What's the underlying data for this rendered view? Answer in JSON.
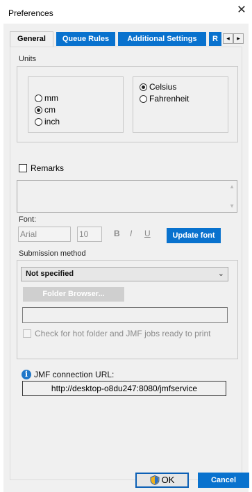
{
  "window": {
    "title": "Preferences",
    "close_glyph": "✕"
  },
  "tabs": [
    {
      "label": "General"
    },
    {
      "label": "Queue Rules"
    },
    {
      "label": "Additional Settings"
    },
    {
      "label": "R"
    }
  ],
  "tab_scroll": {
    "left": "◂",
    "right": "▸"
  },
  "units": {
    "section_label": "Units",
    "length_options": [
      {
        "label": "mm",
        "selected": false
      },
      {
        "label": "cm",
        "selected": true
      },
      {
        "label": "inch",
        "selected": false
      }
    ],
    "temperature_options": [
      {
        "label": "Celsius",
        "selected": true
      },
      {
        "label": "Fahrenheit",
        "selected": false
      }
    ]
  },
  "remarks": {
    "label": "Remarks",
    "checked": false
  },
  "font": {
    "section_label": "Font:",
    "family_value": "Arial",
    "size_value": "10",
    "bold": "B",
    "italic": "I",
    "underline": "U",
    "update_button": "Update font"
  },
  "submission": {
    "section_label": "Submission method",
    "method_value": "Not specified",
    "chevron": "⌄",
    "folder_browser_button": "Folder Browser...",
    "hotfolder_check_label": "Check for hot folder and JMF jobs ready to print"
  },
  "jmf": {
    "info_glyph": "i",
    "label": "JMF connection URL:",
    "url": "http://desktop-o8du247:8080/jmfservice"
  },
  "footer": {
    "ok_label": "OK",
    "cancel_label": "Cancel"
  },
  "colors": {
    "accent_blue": "#0972ce",
    "panel_bg": "#f0f0f0"
  }
}
